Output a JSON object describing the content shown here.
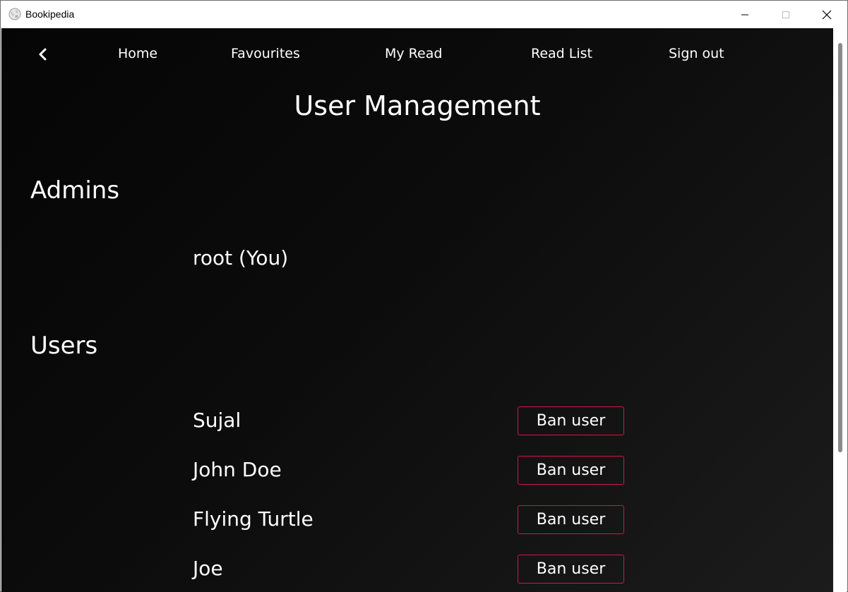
{
  "window": {
    "title": "Bookipedia",
    "icon": "wikipedia-globe-icon"
  },
  "nav": {
    "back_icon": "chevron-left-icon",
    "items": [
      {
        "label": "Home"
      },
      {
        "label": "Favourites"
      },
      {
        "label": "My Read"
      },
      {
        "label": "Read List"
      },
      {
        "label": "Sign out"
      }
    ]
  },
  "page": {
    "title": "User Management"
  },
  "admins": {
    "heading": "Admins",
    "items": [
      {
        "name": "root (You)"
      }
    ]
  },
  "users": {
    "heading": "Users",
    "action_label": "Ban user",
    "items": [
      {
        "name": "Sujal",
        "action": "Ban user"
      },
      {
        "name": "John Doe",
        "action": "Ban user"
      },
      {
        "name": "Flying Turtle",
        "action": "Ban user"
      },
      {
        "name": "Joe",
        "action": "Ban user"
      }
    ]
  },
  "colors": {
    "background": "#0a0a0a",
    "text": "#ffffff",
    "ban_border": "#d1164a"
  }
}
